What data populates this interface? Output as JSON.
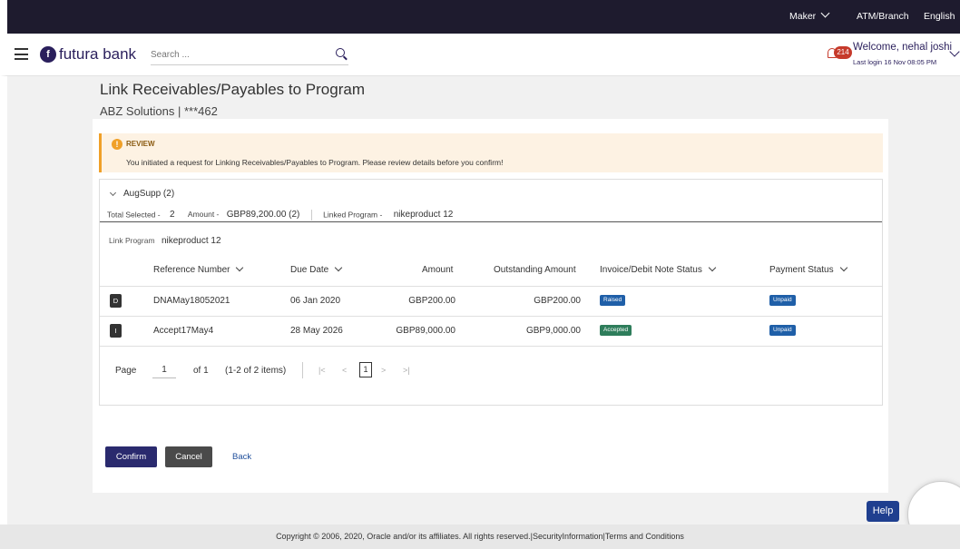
{
  "topbar": {
    "role": "Maker",
    "atm_branch": "ATM/Branch",
    "language": "English"
  },
  "header": {
    "brand": "futura bank",
    "search_placeholder": "Search ...",
    "notification_count": "214",
    "welcome": "Welcome, nehal joshi",
    "last_login": "Last login 16 Nov 08:05 PM"
  },
  "page": {
    "title": "Link Receivables/Payables to Program",
    "subtitle": "ABZ Solutions | ***462"
  },
  "review": {
    "title": "REVIEW",
    "message": "You initiated a request for Linking Receivables/Payables to Program. Please review details before you confirm!"
  },
  "group": {
    "name": "AugSupp  (2)",
    "total_selected_label": "Total Selected -",
    "total_selected_value": "2",
    "amount_label": "Amount -",
    "amount_value": "GBP89,200.00  (2)",
    "linked_program_label": "Linked Program -",
    "linked_program_value": "nikeproduct 12",
    "link_program_label": "Link Program",
    "link_program_value": "nikeproduct 12"
  },
  "table": {
    "headers": {
      "reference": "Reference Number",
      "due_date": "Due Date",
      "amount": "Amount",
      "outstanding": "Outstanding Amount",
      "invoice_status": "Invoice/Debit Note Status",
      "payment_status": "Payment Status"
    },
    "rows": [
      {
        "avatar": "D",
        "reference": "DNAMay18052021",
        "due_date": "06 Jan 2020",
        "amount": "GBP200.00",
        "outstanding": "GBP200.00",
        "invoice_status": "Raised",
        "invoice_status_color": "#1f5fa8",
        "payment_status": "Unpaid",
        "payment_status_color": "#1f5fa8"
      },
      {
        "avatar": "I",
        "reference": "Accept17May4",
        "due_date": "28 May 2026",
        "amount": "GBP89,000.00",
        "outstanding": "GBP9,000.00",
        "invoice_status": "Accepted",
        "invoice_status_color": "#2e7d5b",
        "payment_status": "Unpaid",
        "payment_status_color": "#1f5fa8"
      }
    ]
  },
  "pager": {
    "page_label": "Page",
    "page_value": "1",
    "of_label": "of 1",
    "items_label": "(1-2 of 2 items)",
    "first": "|<",
    "prev": "<",
    "current": "1",
    "next": ">",
    "last": ">|"
  },
  "actions": {
    "confirm": "Confirm",
    "cancel": "Cancel",
    "back": "Back"
  },
  "footer": {
    "text": "Copyright © 2006, 2020, Oracle and/or its affiliates. All rights reserved.|SecurityInformation|Terms and Conditions"
  },
  "help": {
    "label": "Help"
  },
  "colors": {
    "topbar": "#1e1b2e",
    "brand": "#2a1f5c",
    "review_bg": "#fdf2e3",
    "review_accent": "#f0a028",
    "confirm_button": "#2a2a6e",
    "cancel_button": "#4a4a4a",
    "link": "#1f4e9b"
  }
}
